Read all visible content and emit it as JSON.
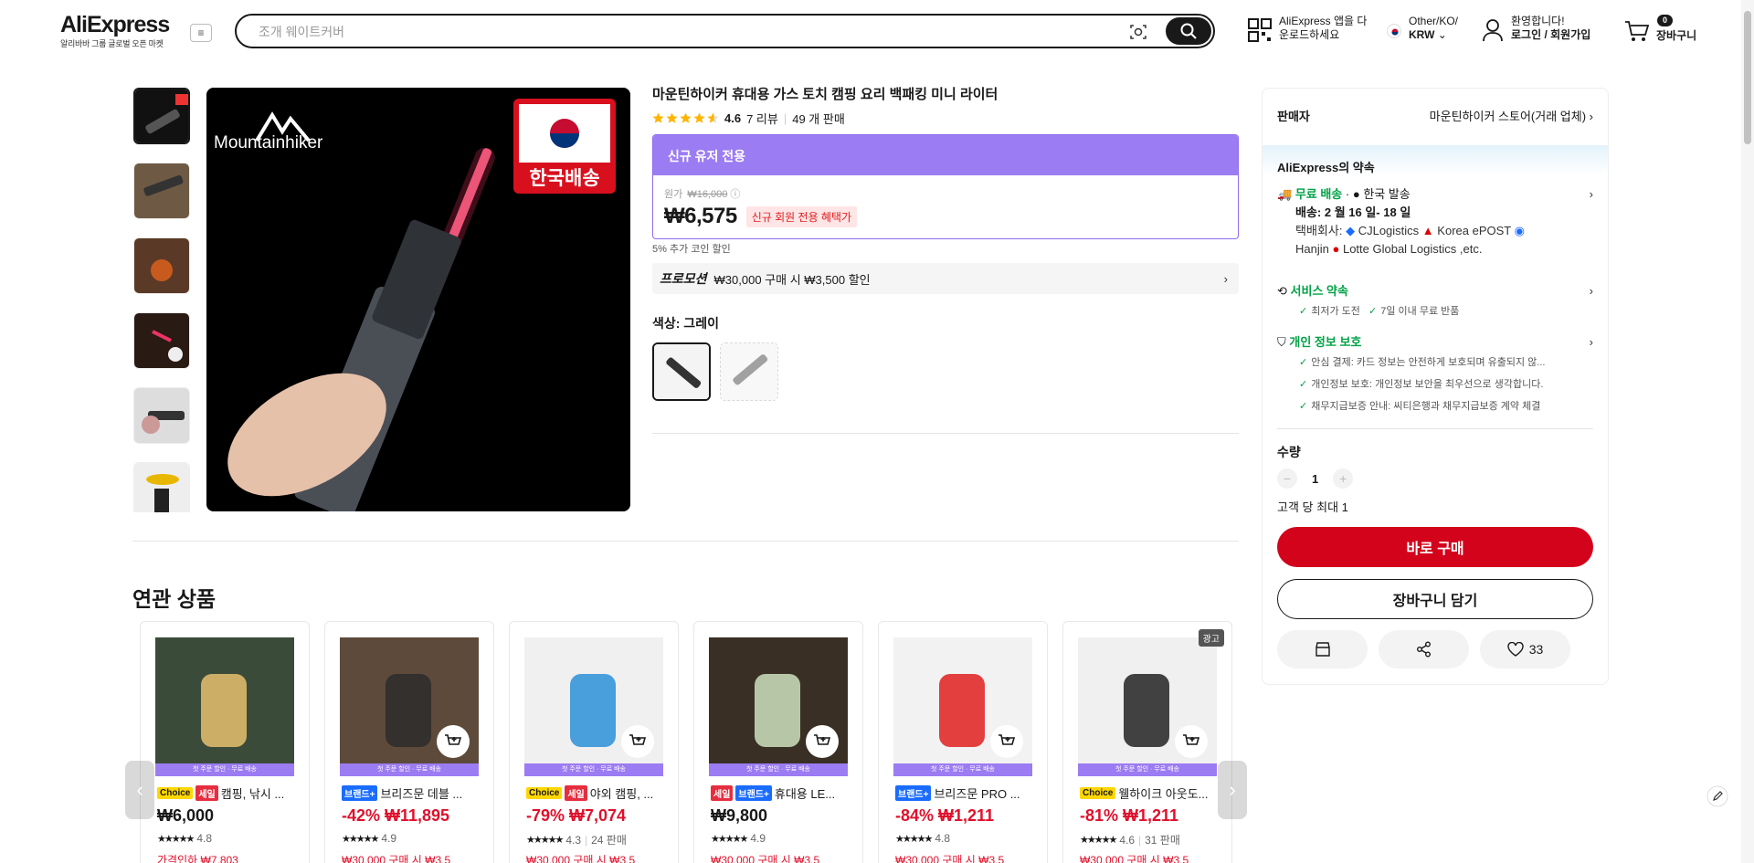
{
  "header": {
    "logo": "AliExpress",
    "logo_tagline": "알리바바 그룹 글로벌 오픈 마켓",
    "search_placeholder": "조개 웨이트커버",
    "app_promo_line1": "AliExpress 앱을 다",
    "app_promo_line2": "운로드하세요",
    "region_line1": "Other/KO/",
    "region_line2": "KRW",
    "greeting": "환영합니다!",
    "login": "로그인 / 회원가입",
    "cart_count": "0",
    "cart_label": "장바구니"
  },
  "product": {
    "title": "마운틴하이커 휴대용 가스 토치 캠핑 요리 백패킹 미니 라이터",
    "rating": "4.6",
    "reviews": "7 리뷰",
    "sold": "49 개 판매",
    "stars_fill": 4.6,
    "image_brand": "Mountainhiker",
    "image_badge": "한국배송",
    "deal_banner": "신규 유저 전용",
    "original_label": "원가",
    "original_price": "₩16,000",
    "price": "₩6,575",
    "price_tag": "신규 회원 전용 혜택가",
    "coin_discount": "5% 추가 코인 할인",
    "promo_label": "프로모션",
    "promo_text": "₩30,000 구매 시 ₩3,500 할인",
    "color_label": "색상: 그레이"
  },
  "sidebar": {
    "seller_label": "판매자",
    "seller_name": "마운틴하이커 스토어(거래 업체)",
    "promise_title": "AliExpress의 약속",
    "free_shipping": "무료 배송",
    "ship_from": "한국 발송",
    "delivery": "배송: 2 월 16 일- 18 일",
    "carrier_label": "택배회사:",
    "carrier1": "CJLogistics",
    "carrier2": "Korea ePOST",
    "carrier3": "Hanjin",
    "carrier4": "Lotte Global Logistics ,etc.",
    "service_title": "서비스 약속",
    "service_item1": "최저가 도전",
    "service_item2": "7일 이내 무료 반품",
    "privacy_title": "개인 정보 보호",
    "privacy_item1": "안심 결제: 카드 정보는 안전하게 보호되며 유출되지 않...",
    "privacy_item2": "개인정보 보호: 개인정보 보안을 최우선으로 생각합니다.",
    "privacy_item3": "채무지급보증 안내: 씨티은행과 채무지급보증 계약 체결",
    "qty_label": "수량",
    "qty_value": "1",
    "qty_limit": "고객 당 최대 1",
    "buy_now": "바로 구매",
    "add_cart": "장바구니 담기",
    "wishlist_count": "33"
  },
  "related": {
    "title": "연관 상품",
    "band_text": "첫 주문 할인 · 무료 배송",
    "items": [
      {
        "badges": [
          "Choice",
          "세일"
        ],
        "name": "캠핑, 낚시 ...",
        "price": "₩6,000",
        "rating": "4.8",
        "sold": "",
        "promo": "가격인하 ₩7,803",
        "ad": ""
      },
      {
        "badges": [
          "브랜드+"
        ],
        "name": "브리즈문 데블 ...",
        "price": "-42% ₩11,895",
        "rating": "4.9",
        "sold": "",
        "promo": "₩30,000 구매 시 ₩3,5",
        "ad": ""
      },
      {
        "badges": [
          "Choice",
          "세일"
        ],
        "name": "야외 캠핑, ...",
        "price": "-79% ₩7,074",
        "rating": "4.3",
        "sold": "24 판매",
        "promo": "₩30,000 구매 시 ₩3,5",
        "ad": ""
      },
      {
        "badges": [
          "세일",
          "브랜드+"
        ],
        "name": "휴대용 LE...",
        "price": "₩9,800",
        "rating": "4.9",
        "sold": "",
        "promo": "₩30,000 구매 시 ₩3,5",
        "ad": ""
      },
      {
        "badges": [
          "브랜드+"
        ],
        "name": "브리즈문 PRO ...",
        "price": "-84% ₩1,211",
        "rating": "4.8",
        "sold": "",
        "promo": "₩30,000 구매 시 ₩3,5",
        "ad": ""
      },
      {
        "badges": [
          "Choice"
        ],
        "name": "웰하이크 아웃도...",
        "price": "-81% ₩1,211",
        "rating": "4.6",
        "sold": "31 판매",
        "promo": "₩30,000 구매 시 ₩3,5",
        "ad": "광고"
      }
    ]
  },
  "colors": {
    "accent_red": "#d3031c",
    "deal_purple": "#9c7cf2",
    "green": "#00a246",
    "star": "#ffb400"
  }
}
